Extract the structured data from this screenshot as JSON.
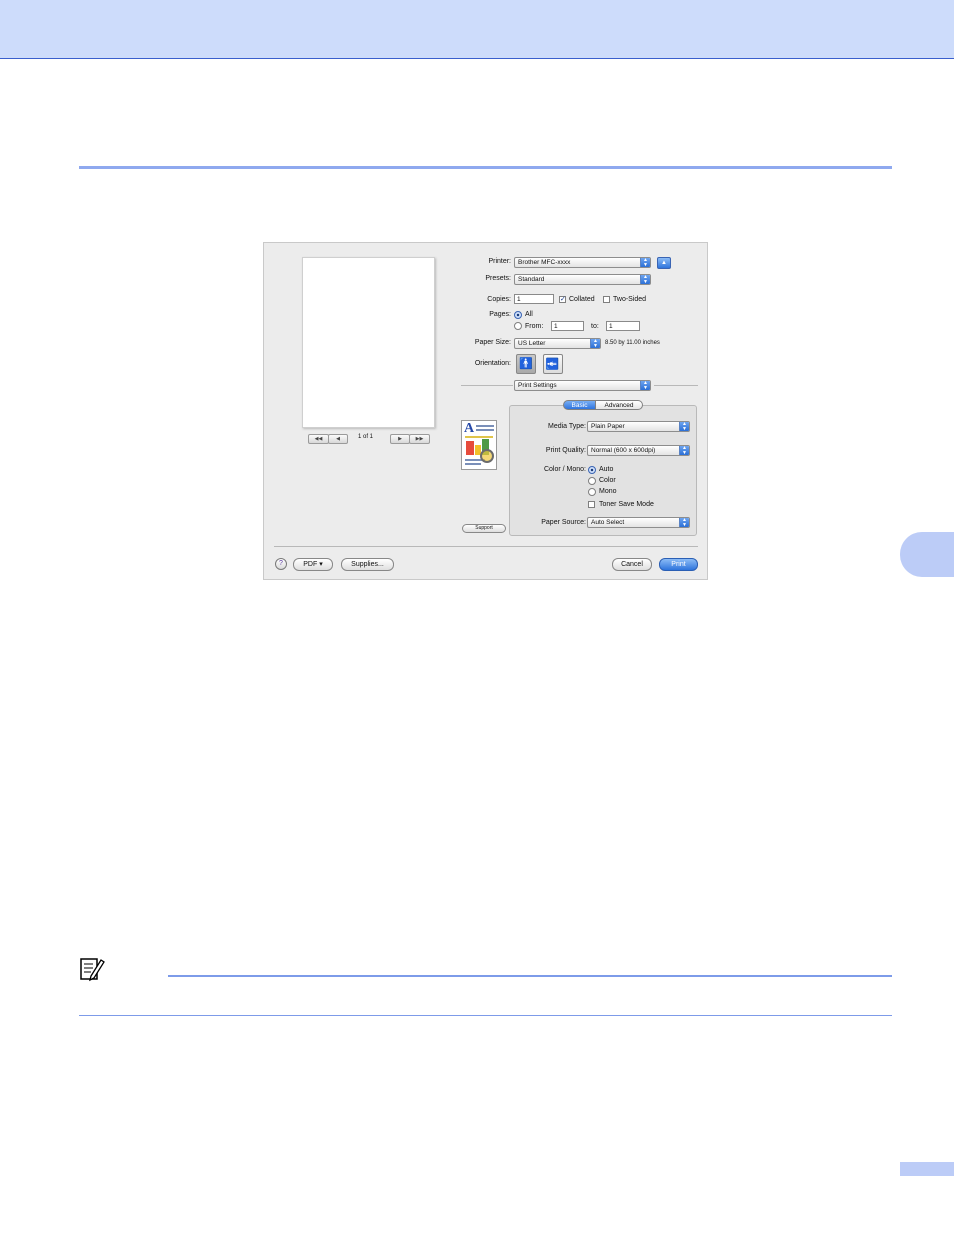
{
  "dialog": {
    "preview": {
      "page_indicator": "1 of 1",
      "first_btn": "◀◀",
      "prev_btn": "◀",
      "next_btn": "▶",
      "last_btn": "▶▶"
    },
    "printer": {
      "label": "Printer:",
      "value": "Brother MFC-xxxx"
    },
    "presets": {
      "label": "Presets:",
      "value": "Standard"
    },
    "copies": {
      "label": "Copies:",
      "value": "1",
      "collated_label": "Collated",
      "collated_checked": true,
      "two_sided_label": "Two-Sided",
      "two_sided_checked": false
    },
    "pages": {
      "label": "Pages:",
      "all_label": "All",
      "from_label": "From:",
      "from_value": "1",
      "to_label": "to:",
      "to_value": "1"
    },
    "paper_size": {
      "label": "Paper Size:",
      "value": "US Letter",
      "dimensions": "8.50 by 11.00 inches"
    },
    "orientation": {
      "label": "Orientation:"
    },
    "panel_select": {
      "value": "Print Settings"
    },
    "tabs": [
      {
        "label": "Basic",
        "selected": true
      },
      {
        "label": "Advanced",
        "selected": false
      }
    ],
    "media_type": {
      "label": "Media Type:",
      "value": "Plain Paper"
    },
    "print_quality": {
      "label": "Print Quality:",
      "value": "Normal (600 x 600dpi)"
    },
    "color_mono": {
      "label": "Color / Mono:",
      "options": [
        "Auto",
        "Color",
        "Mono"
      ],
      "selected": "Auto"
    },
    "toner_save": {
      "label": "Toner Save Mode",
      "checked": false
    },
    "paper_source": {
      "label": "Paper Source:",
      "value": "Auto Select"
    },
    "support_button": "Support",
    "footer": {
      "help": "?",
      "pdf": "PDF ▾",
      "supplies": "Supplies...",
      "cancel": "Cancel",
      "print": "Print"
    }
  },
  "colors": {
    "header_band": "#cddcfb",
    "accent_rule": "#8fa9ef",
    "primary_button": "#2e74dc"
  }
}
